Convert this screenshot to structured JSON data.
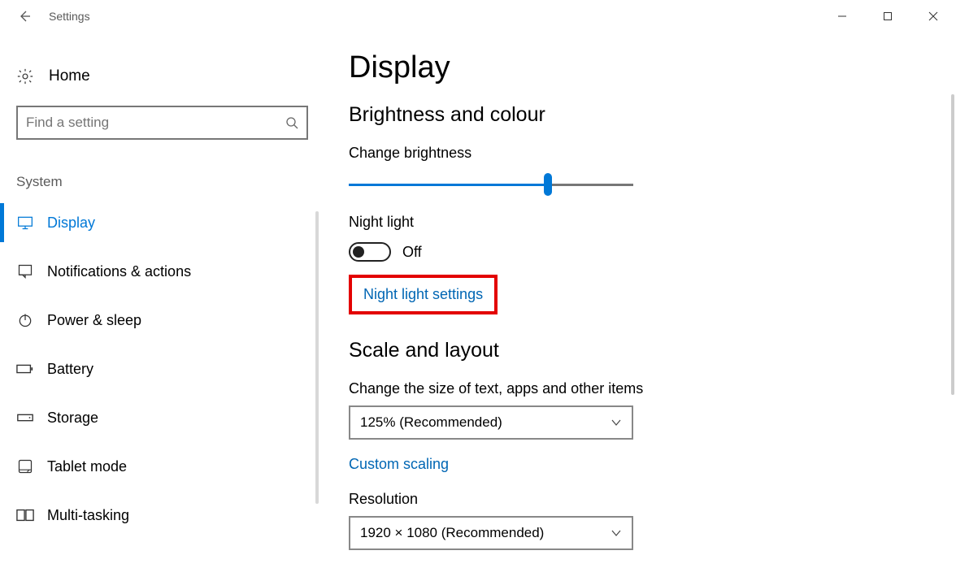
{
  "window": {
    "title": "Settings"
  },
  "sidebar": {
    "home_label": "Home",
    "search_placeholder": "Find a setting",
    "category_label": "System",
    "items": [
      {
        "label": "Display",
        "icon": "monitor-icon",
        "active": true
      },
      {
        "label": "Notifications & actions",
        "icon": "notifications-icon"
      },
      {
        "label": "Power & sleep",
        "icon": "power-icon"
      },
      {
        "label": "Battery",
        "icon": "battery-icon"
      },
      {
        "label": "Storage",
        "icon": "storage-icon"
      },
      {
        "label": "Tablet mode",
        "icon": "tablet-icon"
      },
      {
        "label": "Multi-tasking",
        "icon": "multitasking-icon"
      }
    ]
  },
  "main": {
    "page_title": "Display",
    "section_brightness": "Brightness and colour",
    "brightness_label": "Change brightness",
    "brightness_percent": 68,
    "night_light_label": "Night light",
    "night_light_state": "Off",
    "night_light_settings_link": "Night light settings",
    "section_scale": "Scale and layout",
    "scale_label": "Change the size of text, apps and other items",
    "scale_value": "125% (Recommended)",
    "custom_scaling_link": "Custom scaling",
    "resolution_label": "Resolution",
    "resolution_value": "1920 × 1080 (Recommended)"
  }
}
